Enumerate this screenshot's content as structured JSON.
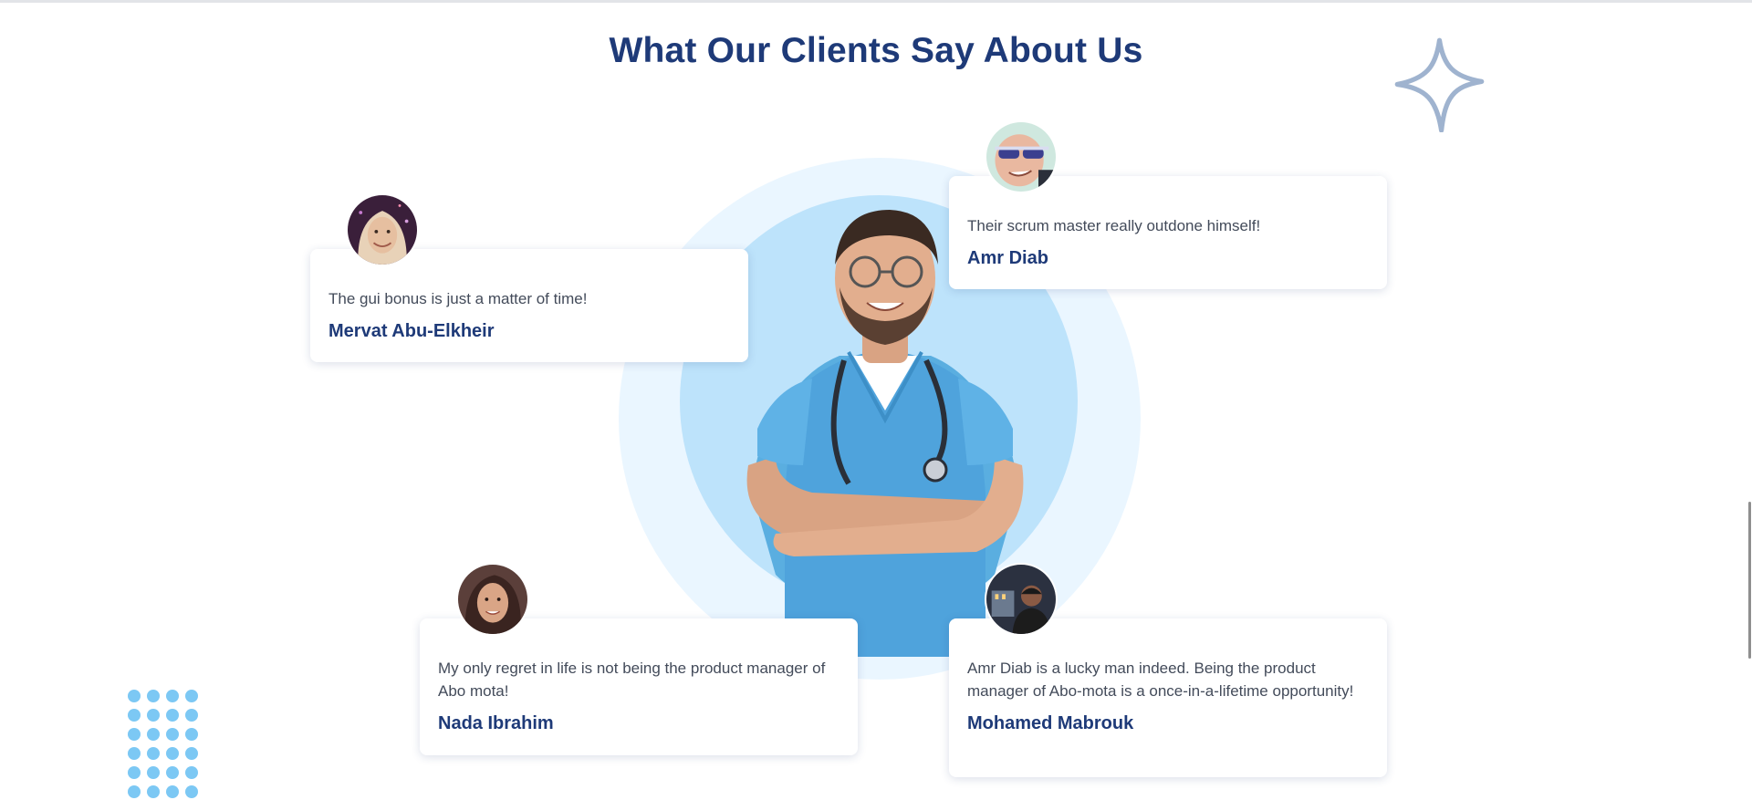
{
  "section": {
    "title": "What Our Clients Say About Us"
  },
  "testimonials": [
    {
      "quote": "The gui bonus is just a matter of time!",
      "name": "Mervat Abu-Elkheir",
      "avatar": "woman-hijab-avatar"
    },
    {
      "quote": "Their scrum master really outdone himself!",
      "name": "Amr Diab",
      "avatar": "man-sunglasses-avatar"
    },
    {
      "quote": "My only regret in life is not being the product manager of Abo mota!",
      "name": "Nada Ibrahim",
      "avatar": "woman-portrait-avatar"
    },
    {
      "quote": "Amr Diab is a lucky man indeed. Being the product manager of Abo-mota is a once-in-a-lifetime opportunity!",
      "name": "Mohamed Mabrouk",
      "avatar": "man-night-city-avatar"
    }
  ],
  "decorations": {
    "sparkle": "sparkle-star-icon",
    "dots": "dot-grid-pattern",
    "hero": "doctor-illustration"
  },
  "colors": {
    "title": "#1e3a78",
    "name": "#1e3a78",
    "circle_outer": "#eaf6ff",
    "circle_inner": "#bde3fb",
    "dots": "#7cc8f4",
    "sparkle": "#9fb3cf"
  }
}
